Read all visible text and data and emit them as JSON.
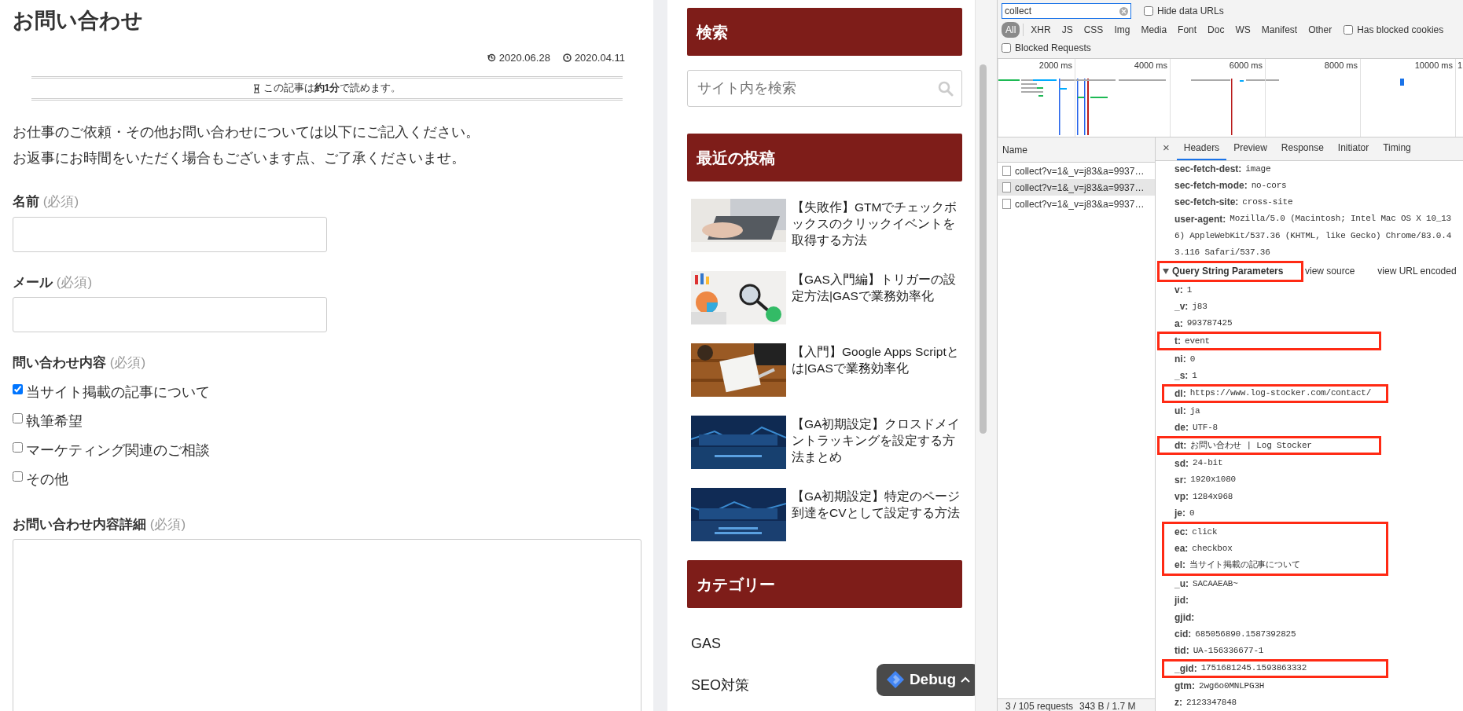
{
  "article": {
    "title": "お問い合わせ",
    "updated": "2020.06.28",
    "published": "2020.04.11",
    "reading_time": "この記事は**約1分**で読めます。",
    "intro": [
      "お仕事のご依頼・その他お問い合わせについては以下にご記入ください。",
      "お返事にお時間をいただく場合もございます点、ご了承くださいませ。"
    ],
    "fields": [
      {
        "kind": "text",
        "label": "名前",
        "required": "(必須)"
      },
      {
        "kind": "text",
        "label": "メール",
        "required": "(必須)"
      },
      {
        "kind": "checkboxes",
        "label": "問い合わせ内容",
        "required": "(必須)",
        "options": [
          {
            "label": "当サイト掲載の記事について",
            "checked": true
          },
          {
            "label": "執筆希望",
            "checked": false
          },
          {
            "label": "マーケティング関連のご相談",
            "checked": false
          },
          {
            "label": "その他",
            "checked": false
          }
        ]
      },
      {
        "kind": "textarea",
        "label": "お問い合わせ内容詳細",
        "required": "(必須)"
      }
    ]
  },
  "sidebar": {
    "search": {
      "heading": "検索",
      "placeholder": "サイト内を検索"
    },
    "recent": {
      "heading": "最近の投稿",
      "posts": [
        {
          "title": "【失敗作】GTMでチェックボックスのクリックイベントを取得する方法",
          "kind": "picture"
        },
        {
          "title": "【GAS入門編】トリガーの設定方法|GASで業務効率化",
          "kind": "picture"
        },
        {
          "title": "【入門】Google Apps Scriptとは|GASで業務効率化",
          "kind": "picture"
        },
        {
          "title": "【GA初期設定】クロスドメイントラッキングを設定する方法まとめ",
          "kind": "picture"
        },
        {
          "title": "【GA初期設定】特定のページ到達をCVとして設定する方法",
          "kind": "picture"
        }
      ]
    },
    "categories": {
      "heading": "カテゴリー",
      "items": [
        "GAS",
        "SEO対策"
      ]
    }
  },
  "debug_button": {
    "label": "Debug"
  },
  "devtools": {
    "filter": {
      "value": "collect"
    },
    "hide_data_urls": {
      "label": "Hide data URLs",
      "checked": false
    },
    "type_filters": [
      {
        "label": "All",
        "selected": true
      },
      {
        "label": "XHR",
        "selected": false
      },
      {
        "label": "JS",
        "selected": false
      },
      {
        "label": "CSS",
        "selected": false
      },
      {
        "label": "Img",
        "selected": false
      },
      {
        "label": "Media",
        "selected": false
      },
      {
        "label": "Font",
        "selected": false
      },
      {
        "label": "Doc",
        "selected": false
      },
      {
        "label": "WS",
        "selected": false
      },
      {
        "label": "Manifest",
        "selected": false
      },
      {
        "label": "Other",
        "selected": false
      }
    ],
    "has_blocked_cookies": {
      "label": "Has blocked cookies",
      "checked": false
    },
    "blocked_requests": {
      "label": "Blocked Requests",
      "checked": false
    },
    "timeline_ticks": [
      "2000 ms",
      "4000 ms",
      "6000 ms",
      "8000 ms",
      "10000 ms",
      "1"
    ],
    "requests": {
      "column": "Name",
      "rows": [
        {
          "name": "collect?v=1&_v=j83&a=9937…",
          "selected": false
        },
        {
          "name": "collect?v=1&_v=j83&a=9937…",
          "selected": true
        },
        {
          "name": "collect?v=1&_v=j83&a=9937…",
          "selected": false
        }
      ]
    },
    "status": [
      "3 / 105 requests",
      "343 B / 1.7 M"
    ],
    "close_label": "×",
    "detail_tabs": [
      {
        "label": "Headers",
        "selected": true
      },
      {
        "label": "Preview",
        "selected": false
      },
      {
        "label": "Response",
        "selected": false
      },
      {
        "label": "Initiator",
        "selected": false
      },
      {
        "label": "Timing",
        "selected": false
      }
    ],
    "headers": [
      {
        "key": "sec-fetch-dest:",
        "value_lines": [
          "image"
        ]
      },
      {
        "key": "sec-fetch-mode:",
        "value_lines": [
          "no-cors"
        ]
      },
      {
        "key": "sec-fetch-site:",
        "value_lines": [
          "cross-site"
        ]
      },
      {
        "key": "user-agent:",
        "value_lines": [
          "Mozilla/5.0 (Macintosh; Intel Mac OS X 10_13",
          "6) AppleWebKit/537.36 (KHTML, like Gecko) Chrome/83.0.4",
          "3.116 Safari/537.36"
        ]
      }
    ],
    "query": {
      "title": "Query String Parameters",
      "expanded": true,
      "highlighted": true,
      "view_source": "view source",
      "view_url_encoded": "view URL encoded",
      "groups": [
        {
          "highlighted": false,
          "params": [
            {
              "key": "v:",
              "value": "1"
            },
            {
              "key": "_v:",
              "value": "j83"
            },
            {
              "key": "a:",
              "value": "993787425"
            }
          ]
        },
        {
          "highlighted": true,
          "params": [
            {
              "key": "t:",
              "value": "event"
            }
          ]
        },
        {
          "highlighted": false,
          "params": [
            {
              "key": "ni:",
              "value": "0"
            },
            {
              "key": "_s:",
              "value": "1"
            }
          ]
        },
        {
          "highlighted": true,
          "params": [
            {
              "key": "dl:",
              "value": "https://www.log-stocker.com/contact/"
            }
          ]
        },
        {
          "highlighted": false,
          "params": [
            {
              "key": "ul:",
              "value": "ja"
            },
            {
              "key": "de:",
              "value": "UTF-8"
            }
          ]
        },
        {
          "highlighted": true,
          "params": [
            {
              "key": "dt:",
              "value": "お問い合わせ | Log Stocker"
            }
          ]
        },
        {
          "highlighted": false,
          "params": [
            {
              "key": "sd:",
              "value": "24-bit"
            },
            {
              "key": "sr:",
              "value": "1920x1080"
            },
            {
              "key": "vp:",
              "value": "1284x968"
            },
            {
              "key": "je:",
              "value": "0"
            }
          ]
        },
        {
          "highlighted": true,
          "params": [
            {
              "key": "ec:",
              "value": "click"
            },
            {
              "key": "ea:",
              "value": "checkbox"
            },
            {
              "key": "el:",
              "value": "当サイト掲載の記事について"
            }
          ]
        },
        {
          "highlighted": false,
          "params": [
            {
              "key": "_u:",
              "value": "SACAAEAB~"
            },
            {
              "key": "jid:"
            },
            {
              "key": "gjid:"
            },
            {
              "key": "cid:",
              "value": "685056890.1587392825"
            },
            {
              "key": "tid:",
              "value": "UA-156336677-1"
            }
          ]
        },
        {
          "highlighted": true,
          "params": [
            {
              "key": "_gid:",
              "value": "1751681245.1593863332"
            }
          ]
        },
        {
          "highlighted": false,
          "params": [
            {
              "key": "gtm:",
              "value": "2wg6o0MNLPG3H"
            },
            {
              "key": "z:",
              "value": "2123347848"
            }
          ]
        }
      ]
    }
  }
}
